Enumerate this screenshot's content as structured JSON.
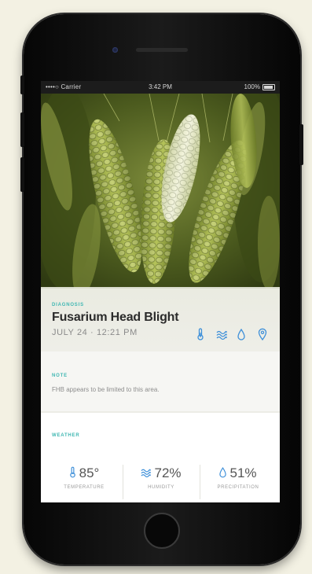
{
  "status_bar": {
    "carrier": "••••○ Carrier",
    "time": "3:42 PM",
    "battery": "100%"
  },
  "diagnosis": {
    "label": "DIAGNOSIS",
    "title": "Fusarium Head Blight",
    "date": "JULY 24 · 12:21 PM",
    "icons": [
      "thermometer-icon",
      "humidity-icon",
      "drop-icon",
      "location-pin-icon"
    ]
  },
  "note": {
    "label": "NOTE",
    "text": "FHB appears to be limited to this area."
  },
  "weather": {
    "label": "WEATHER",
    "metrics": [
      {
        "value": "85°",
        "caption": "TEMPERATURE",
        "icon": "thermometer-icon"
      },
      {
        "value": "72%",
        "caption": "HUMIDITY",
        "icon": "humidity-icon"
      },
      {
        "value": "51%",
        "caption": "PRECIPITATION",
        "icon": "drop-icon"
      }
    ]
  },
  "colors": {
    "accent": "#3fb7b2",
    "icon_blue": "#3d8fd9",
    "title": "#2b2b2b"
  }
}
